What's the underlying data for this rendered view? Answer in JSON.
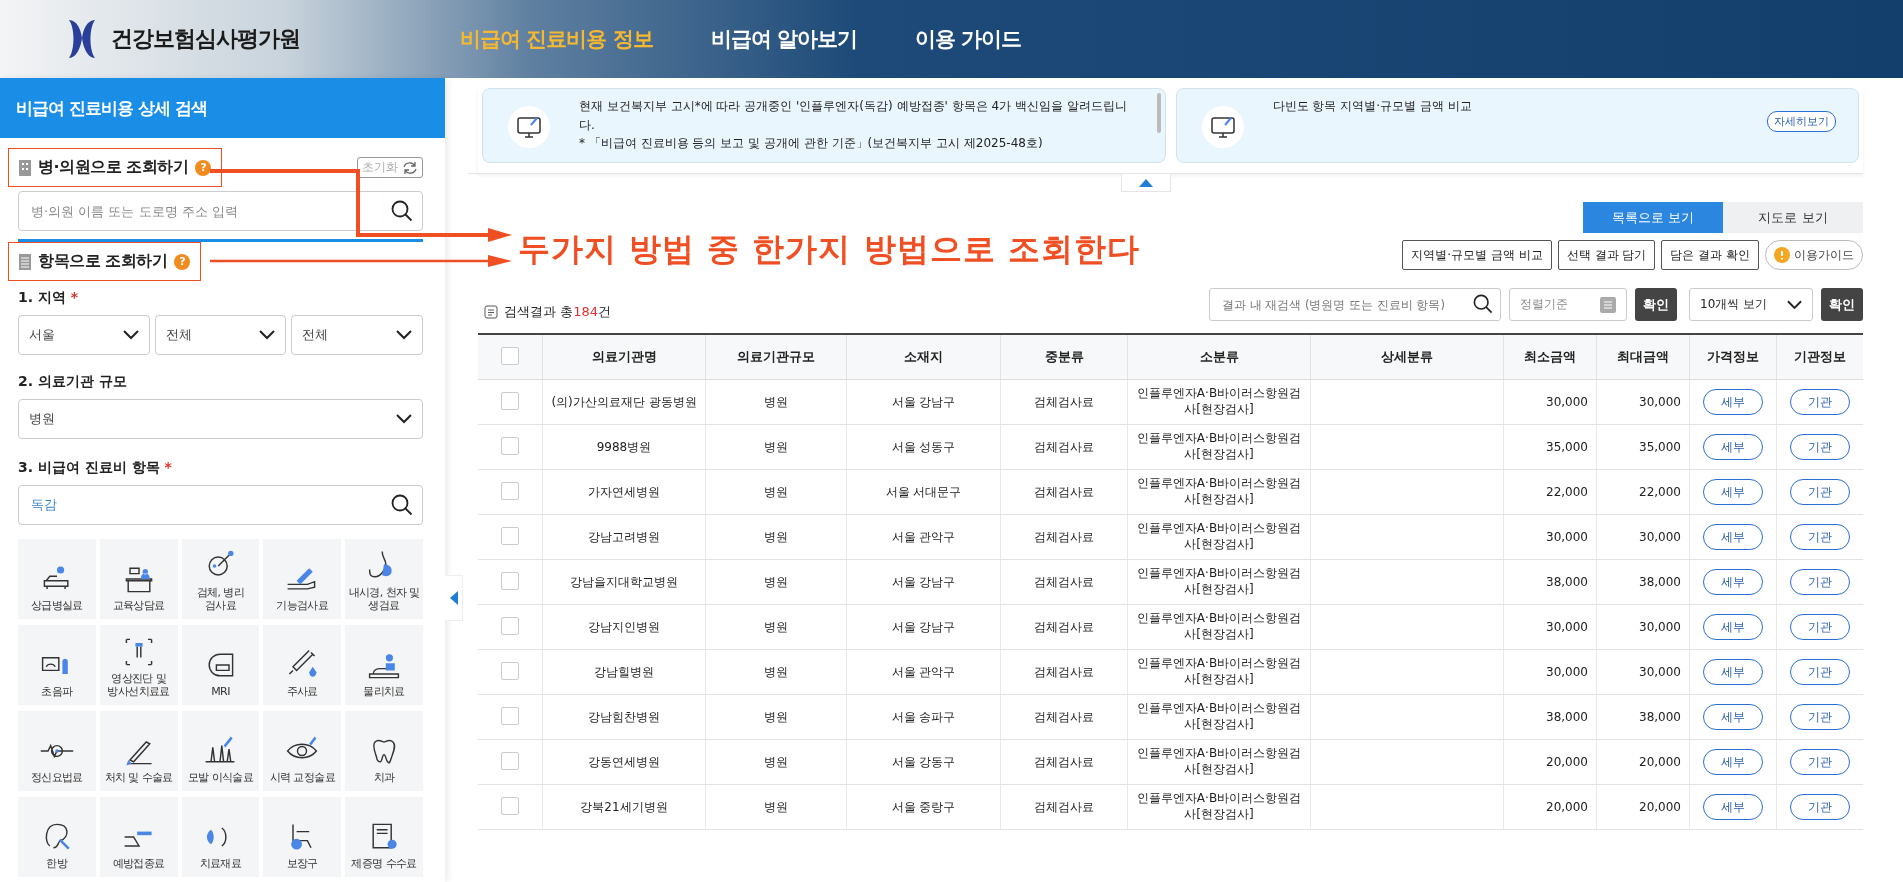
{
  "header": {
    "logo_text": "건강보험심사평가원",
    "nav": [
      {
        "label": "비급여 진료비용 정보",
        "selected": true
      },
      {
        "label": "비급여 알아보기",
        "selected": false
      },
      {
        "label": "이용 가이드",
        "selected": false
      }
    ]
  },
  "sidebar": {
    "title": "비급여 진료비용 상세 검색",
    "hospital_search": {
      "heading": "병·의원으로 조회하기",
      "help": "?",
      "reset": "초기화",
      "placeholder": "병·의원 이름 또는 도로명 주소 입력"
    },
    "item_search": {
      "heading": "항목으로 조회하기",
      "help": "?",
      "region": {
        "label": "1. 지역",
        "required_mark": "*",
        "selects": [
          "서울",
          "전체",
          "전체"
        ]
      },
      "size": {
        "label": "2. 의료기관 규모",
        "select": "병원"
      },
      "item": {
        "label": "3. 비급여 진료비 항목",
        "required_mark": "*",
        "value": "독감"
      },
      "categories": [
        "상급병실료",
        "교육상담료",
        "검체, 병리 검사료",
        "기능검사료",
        "내시경, 천자 및 생검료",
        "초음파",
        "영상진단 및 방사선치료료",
        "MRI",
        "주사료",
        "물리치료",
        "정신요법료",
        "처치 및 수술료",
        "모발 이식술료",
        "시력 교정술료",
        "치과",
        "한방",
        "예방접종료",
        "치료재료",
        "보장구",
        "제증명 수수료"
      ]
    }
  },
  "notices": [
    {
      "text": "현재 보건복지부 고시*에 따라 공개중인 '인플루엔자(독감) 예방접종' 항목은 4가 백신임을 알려드립니다.",
      "note": "* 「비급여 진료비용 등의 보고 및 공개에 관한 기준」(보건복지부 고시 제2025-48호)"
    },
    {
      "text": "다빈도 항목 지역별·규모별 금액 비교",
      "link": "자세히보기"
    }
  ],
  "annotation": {
    "text": "두가지 방법 중 한가지 방법으로 조회한다"
  },
  "view_toggle": [
    {
      "label": "목록으로 보기",
      "selected": true
    },
    {
      "label": "지도로 보기",
      "selected": false
    }
  ],
  "actions": [
    {
      "kind": "button",
      "label": "지역별·규모별 금액 비교"
    },
    {
      "kind": "button",
      "label": "선택 결과 담기"
    },
    {
      "kind": "button",
      "label": "담은 결과 확인"
    },
    {
      "kind": "guide",
      "label": "이용가이드"
    }
  ],
  "results": {
    "prefix": "검색결과 총",
    "count": "184",
    "suffix": "건",
    "search_placeholder": "결과 내 재검색 (병원명 또는 진료비 항목)",
    "sort_placeholder": "정렬기준",
    "confirm": "확인",
    "page_size": "10개씩 보기",
    "confirm_page": "확인"
  },
  "table": {
    "header_checked": false,
    "columns": [
      "의료기관명",
      "의료기관규모",
      "소재지",
      "중분류",
      "소분류",
      "상세분류",
      "최소금액",
      "최대금액",
      "가격정보",
      "기관정보"
    ],
    "rows": [
      {
        "checked": false,
        "cells": [
          "(의)가산의료재단 광동병원",
          "병원",
          "서울 강남구",
          "검체검사료",
          "인플루엔자A·B바이러스항원검사[현장검사]",
          "",
          "30,000",
          "30,000"
        ],
        "price_button": "세부",
        "org_button": "기관"
      },
      {
        "checked": false,
        "cells": [
          "9988병원",
          "병원",
          "서울 성동구",
          "검체검사료",
          "인플루엔자A·B바이러스항원검사[현장검사]",
          "",
          "35,000",
          "35,000"
        ],
        "price_button": "세부",
        "org_button": "기관"
      },
      {
        "checked": false,
        "cells": [
          "가자연세병원",
          "병원",
          "서울 서대문구",
          "검체검사료",
          "인플루엔자A·B바이러스항원검사[현장검사]",
          "",
          "22,000",
          "22,000"
        ],
        "price_button": "세부",
        "org_button": "기관"
      },
      {
        "checked": false,
        "cells": [
          "강남고려병원",
          "병원",
          "서울 관악구",
          "검체검사료",
          "인플루엔자A·B바이러스항원검사[현장검사]",
          "",
          "30,000",
          "30,000"
        ],
        "price_button": "세부",
        "org_button": "기관"
      },
      {
        "checked": false,
        "cells": [
          "강남을지대학교병원",
          "병원",
          "서울 강남구",
          "검체검사료",
          "인플루엔자A·B바이러스항원검사[현장검사]",
          "",
          "38,000",
          "38,000"
        ],
        "price_button": "세부",
        "org_button": "기관"
      },
      {
        "checked": false,
        "cells": [
          "강남지인병원",
          "병원",
          "서울 강남구",
          "검체검사료",
          "인플루엔자A·B바이러스항원검사[현장검사]",
          "",
          "30,000",
          "30,000"
        ],
        "price_button": "세부",
        "org_button": "기관"
      },
      {
        "checked": false,
        "cells": [
          "강남힐병원",
          "병원",
          "서울 관악구",
          "검체검사료",
          "인플루엔자A·B바이러스항원검사[현장검사]",
          "",
          "30,000",
          "30,000"
        ],
        "price_button": "세부",
        "org_button": "기관"
      },
      {
        "checked": false,
        "cells": [
          "강남힘찬병원",
          "병원",
          "서울 송파구",
          "검체검사료",
          "인플루엔자A·B바이러스항원검사[현장검사]",
          "",
          "38,000",
          "38,000"
        ],
        "price_button": "세부",
        "org_button": "기관"
      },
      {
        "checked": false,
        "cells": [
          "강동연세병원",
          "병원",
          "서울 강동구",
          "검체검사료",
          "인플루엔자A·B바이러스항원검사[현장검사]",
          "",
          "20,000",
          "20,000"
        ],
        "price_button": "세부",
        "org_button": "기관"
      },
      {
        "checked": false,
        "cells": [
          "강북21세기병원",
          "병원",
          "서울 중랑구",
          "검체검사료",
          "인플루엔자A·B바이러스항원검사[현장검사]",
          "",
          "20,000",
          "20,000"
        ],
        "price_button": "세부",
        "org_button": "기관"
      }
    ]
  }
}
